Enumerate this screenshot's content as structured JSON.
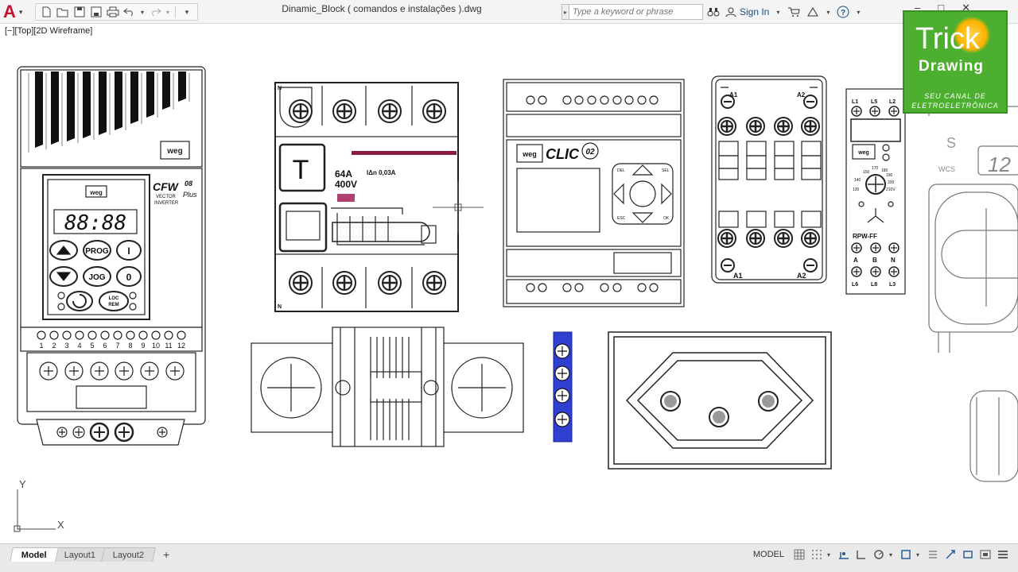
{
  "app": {
    "logo": "A",
    "accent": "#c8102e"
  },
  "document": {
    "title": "Dinamic_Block ( comandos e instalações ).dwg"
  },
  "viewport": {
    "label": "[−][Top][2D Wireframe]"
  },
  "search": {
    "placeholder": "Type a keyword or phrase"
  },
  "account": {
    "sign_in": "Sign In"
  },
  "window": {
    "minimize": "–",
    "maximize": "□",
    "close": "✕"
  },
  "ucs": {
    "x_label": "X",
    "y_label": "Y"
  },
  "badge": {
    "line1": "Trick",
    "line2": "Drawing",
    "sub1": "SEU CANAL DE",
    "sub2": "ELETROELETRÔNICA",
    "bg_color": "#4caf2f"
  },
  "blocks": {
    "inverter": {
      "brand": "weg",
      "model": "CFW",
      "model_sup": "08",
      "model_plus": "Plus",
      "type_line1": "VECTOR",
      "type_line2": "INVERTER",
      "display": "88:88",
      "btn_prog": "PROG",
      "btn_jog": "JOG",
      "btn_i": "I",
      "btn_o": "0",
      "btn_loc": "LOC",
      "btn_rem": "REM",
      "terminals": [
        "1",
        "2",
        "3",
        "4",
        "5",
        "6",
        "7",
        "8",
        "9",
        "10",
        "11",
        "12"
      ]
    },
    "breaker": {
      "test_button": "T",
      "rating_current": "64A",
      "rating_voltage": "400V",
      "sensitivity": "IΔn 0,03A",
      "pole_n_top": "N",
      "pole_n_bottom": "N"
    },
    "clp": {
      "brand": "weg",
      "model": "CLIC",
      "model_sup": "02",
      "key_esc": "ESC",
      "key_del": "DEL",
      "key_sel": "SEL",
      "key_ok": "OK"
    },
    "contactor": {
      "top_left": "A1",
      "top_right": "A2",
      "bottom_left": "A1",
      "bottom_right": "A2"
    },
    "relay": {
      "brand": "weg",
      "top_terms": [
        "L1",
        "L5",
        "L2"
      ],
      "bottom_terms": [
        "L6",
        "L8",
        "L3"
      ],
      "mid_terms": [
        "A",
        "B",
        "N"
      ],
      "model": "RPW-FF",
      "scale": [
        "150",
        "170",
        "180",
        "190",
        "200",
        "210V"
      ],
      "scale_left": "140",
      "scale_bottom": "130"
    },
    "partial": {
      "wcs": "WCS",
      "number": "12",
      "letter": "S"
    }
  },
  "tabs": {
    "model": "Model",
    "layout1": "Layout1",
    "layout2": "Layout2",
    "add": "+"
  },
  "status": {
    "space": "MODEL"
  }
}
